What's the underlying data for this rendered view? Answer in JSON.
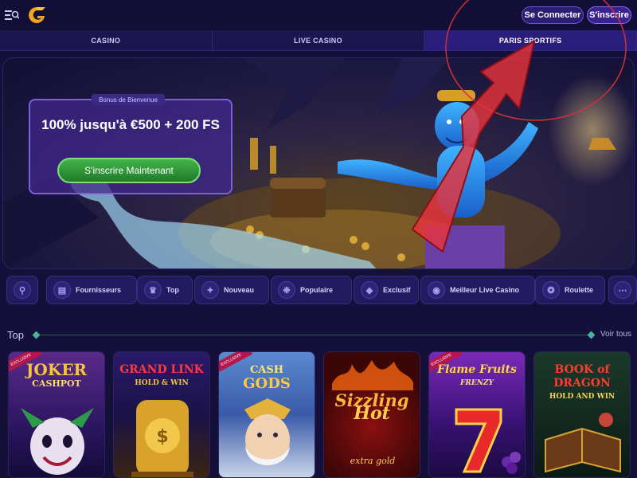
{
  "header": {
    "login_label": "Se Connecter",
    "signup_label": "S'inscrire"
  },
  "tabs": [
    {
      "label": "CASINO",
      "active": false
    },
    {
      "label": "LIVE CASINO",
      "active": false
    },
    {
      "label": "PARIS SPORTIFS",
      "active": true
    }
  ],
  "hero": {
    "tag": "Bonus de Bienvenue",
    "title": "100% jusqu'à €500 + 200 FS",
    "cta_label": "S'inscrire Maintenant"
  },
  "chips": [
    {
      "label": "",
      "icon": "search-icon"
    },
    {
      "label": "Fournisseurs",
      "icon": "providers-icon"
    },
    {
      "label": "Top",
      "icon": "crown-icon"
    },
    {
      "label": "Nouveau",
      "icon": "sparkle-icon"
    },
    {
      "label": "Populaire",
      "icon": "flame-icon"
    },
    {
      "label": "Exclusif",
      "icon": "diamond-icon"
    },
    {
      "label": "Meilleur Live Casino",
      "icon": "live-icon"
    },
    {
      "label": "Roulette",
      "icon": "roulette-icon"
    },
    {
      "label": "",
      "icon": "more-icon"
    }
  ],
  "section": {
    "title": "Top",
    "see_all": "Voir tous"
  },
  "games": [
    {
      "line1": "JOKER",
      "line2": "CASHPOT",
      "exclusive": true
    },
    {
      "line1": "GRAND LINK",
      "line2": "HOLD & WIN",
      "exclusive": false
    },
    {
      "line1": "CASH",
      "line2": "GODS",
      "exclusive": true
    },
    {
      "line1": "Sizzling",
      "line2": "Hot",
      "exclusive": false
    },
    {
      "line1": "Flame Fruits",
      "line2": "FRENZY",
      "exclusive": true
    },
    {
      "line1": "BOOK of DRAGON",
      "line2": "HOLD AND WIN",
      "exclusive": false
    }
  ],
  "colors": {
    "background": "#14103a",
    "accent": "#6c57d8",
    "cta_green": "#2e9a36",
    "annotation_red": "#e8333c"
  }
}
